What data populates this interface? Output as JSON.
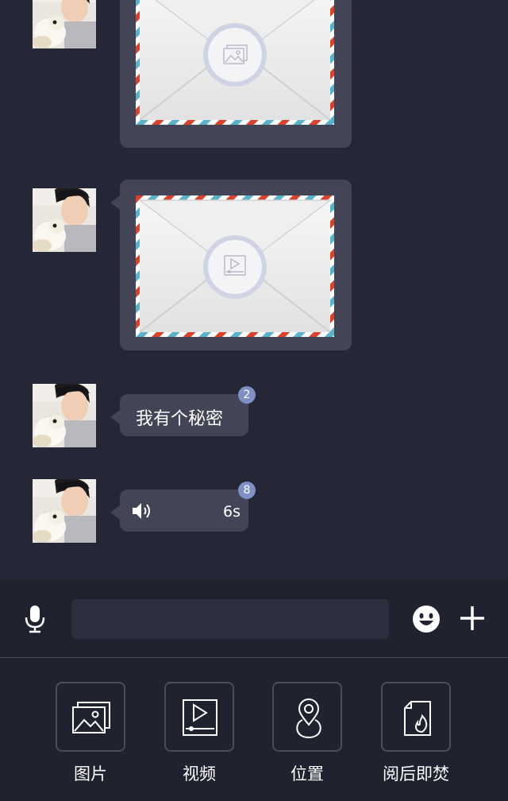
{
  "messages": [
    {
      "type": "image",
      "icon": "image-icon"
    },
    {
      "type": "video",
      "icon": "video-icon"
    },
    {
      "type": "text",
      "text": "我有个秘密",
      "badge": "2"
    },
    {
      "type": "voice",
      "duration": "6s",
      "badge": "8",
      "icon": "speaker-icon"
    }
  ],
  "input_bar": {
    "mic_icon": "microphone-icon",
    "input_value": "",
    "emoji_icon": "emoji-icon",
    "plus_icon": "plus-icon"
  },
  "tools": [
    {
      "label": "图片",
      "icon": "image-icon"
    },
    {
      "label": "视频",
      "icon": "video-icon"
    },
    {
      "label": "位置",
      "icon": "location-pin-icon"
    },
    {
      "label": "阅后即焚",
      "icon": "burn-after-reading-icon"
    }
  ],
  "colors": {
    "background": "#262736",
    "bubble": "#434556",
    "badge": "#7e90c6",
    "panel": "#212230"
  }
}
